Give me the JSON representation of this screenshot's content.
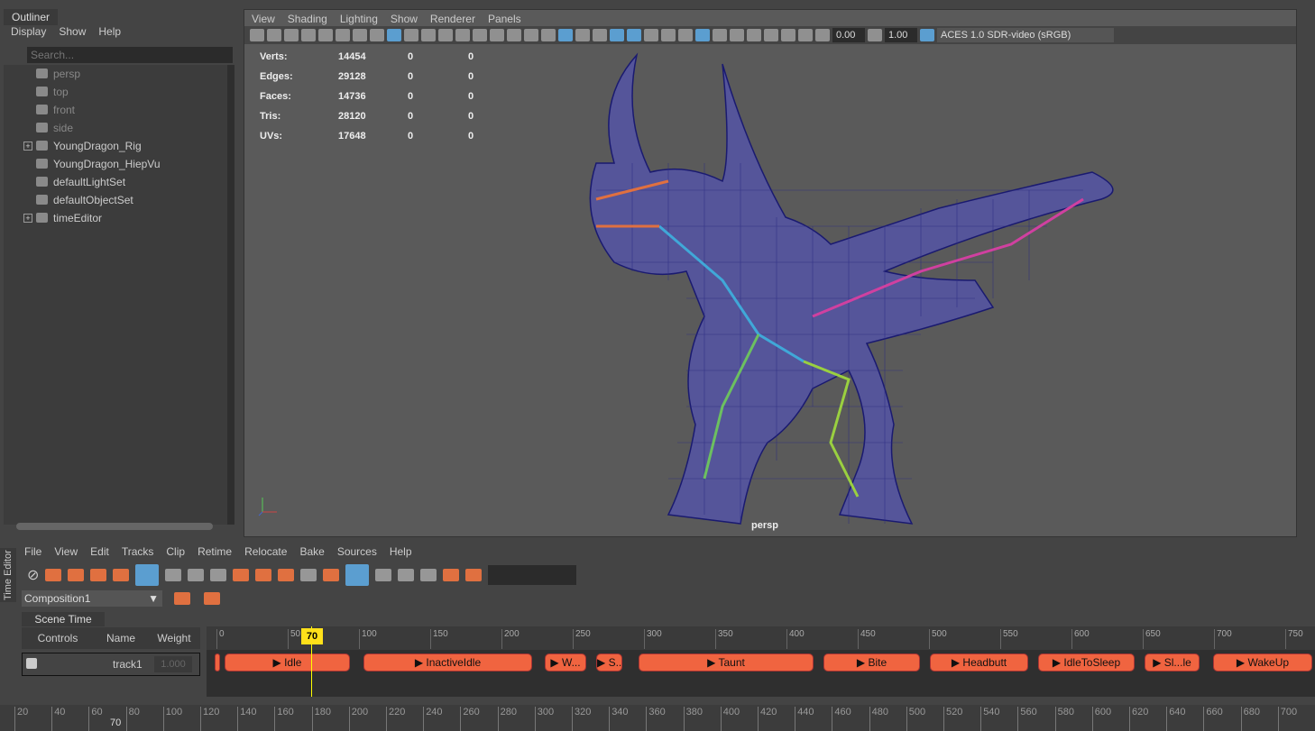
{
  "outliner": {
    "title": "Outliner",
    "menu": [
      "Display",
      "Show",
      "Help"
    ],
    "search_placeholder": "Search...",
    "items": [
      {
        "label": "persp",
        "dim": true
      },
      {
        "label": "top",
        "dim": true
      },
      {
        "label": "front",
        "dim": true
      },
      {
        "label": "side",
        "dim": true
      },
      {
        "label": "YoungDragon_Rig",
        "expand": "+"
      },
      {
        "label": "YoungDragon_HiepVu"
      },
      {
        "label": "defaultLightSet"
      },
      {
        "label": "defaultObjectSet"
      },
      {
        "label": "timeEditor",
        "expand": "+"
      }
    ]
  },
  "viewport": {
    "menu": [
      "View",
      "Shading",
      "Lighting",
      "Show",
      "Renderer",
      "Panels"
    ],
    "exposure": "0.00",
    "gamma": "1.00",
    "color_space": "ACES 1.0 SDR-video (sRGB)",
    "camera": "persp",
    "stats": [
      [
        "Verts:",
        "14454",
        "0",
        "0"
      ],
      [
        "Edges:",
        "29128",
        "0",
        "0"
      ],
      [
        "Faces:",
        "14736",
        "0",
        "0"
      ],
      [
        "Tris:",
        "28120",
        "0",
        "0"
      ],
      [
        "UVs:",
        "17648",
        "0",
        "0"
      ]
    ]
  },
  "time_editor": {
    "side_label": "Time Editor",
    "menu": [
      "File",
      "View",
      "Edit",
      "Tracks",
      "Clip",
      "Retime",
      "Relocate",
      "Bake",
      "Sources",
      "Help"
    ],
    "composition": "Composition1",
    "tab": "Scene Time",
    "headers": [
      "Controls",
      "Name",
      "Weight"
    ],
    "track": {
      "name": "track1",
      "weight": "1.000"
    },
    "current_frame": "70",
    "ruler": [
      "0",
      "50",
      "100",
      "150",
      "200",
      "250",
      "300",
      "350",
      "400",
      "450",
      "500",
      "550",
      "600",
      "650",
      "700",
      "750"
    ],
    "clips": [
      "",
      "Idle",
      "InactiveIdle",
      "W...",
      "S...",
      "Taunt",
      "Bite",
      "Headbutt",
      "IdleToSleep",
      "Sl...le",
      "WakeUp"
    ]
  },
  "time_slider": {
    "labels": [
      "20",
      "40",
      "60",
      "80",
      "100",
      "120",
      "140",
      "160",
      "180",
      "200",
      "220",
      "240",
      "260",
      "280",
      "300",
      "320",
      "340",
      "360",
      "380",
      "400",
      "420",
      "440",
      "460",
      "480",
      "500",
      "520",
      "540",
      "560",
      "580",
      "600",
      "620",
      "640",
      "660",
      "680",
      "700"
    ],
    "current": "70"
  }
}
